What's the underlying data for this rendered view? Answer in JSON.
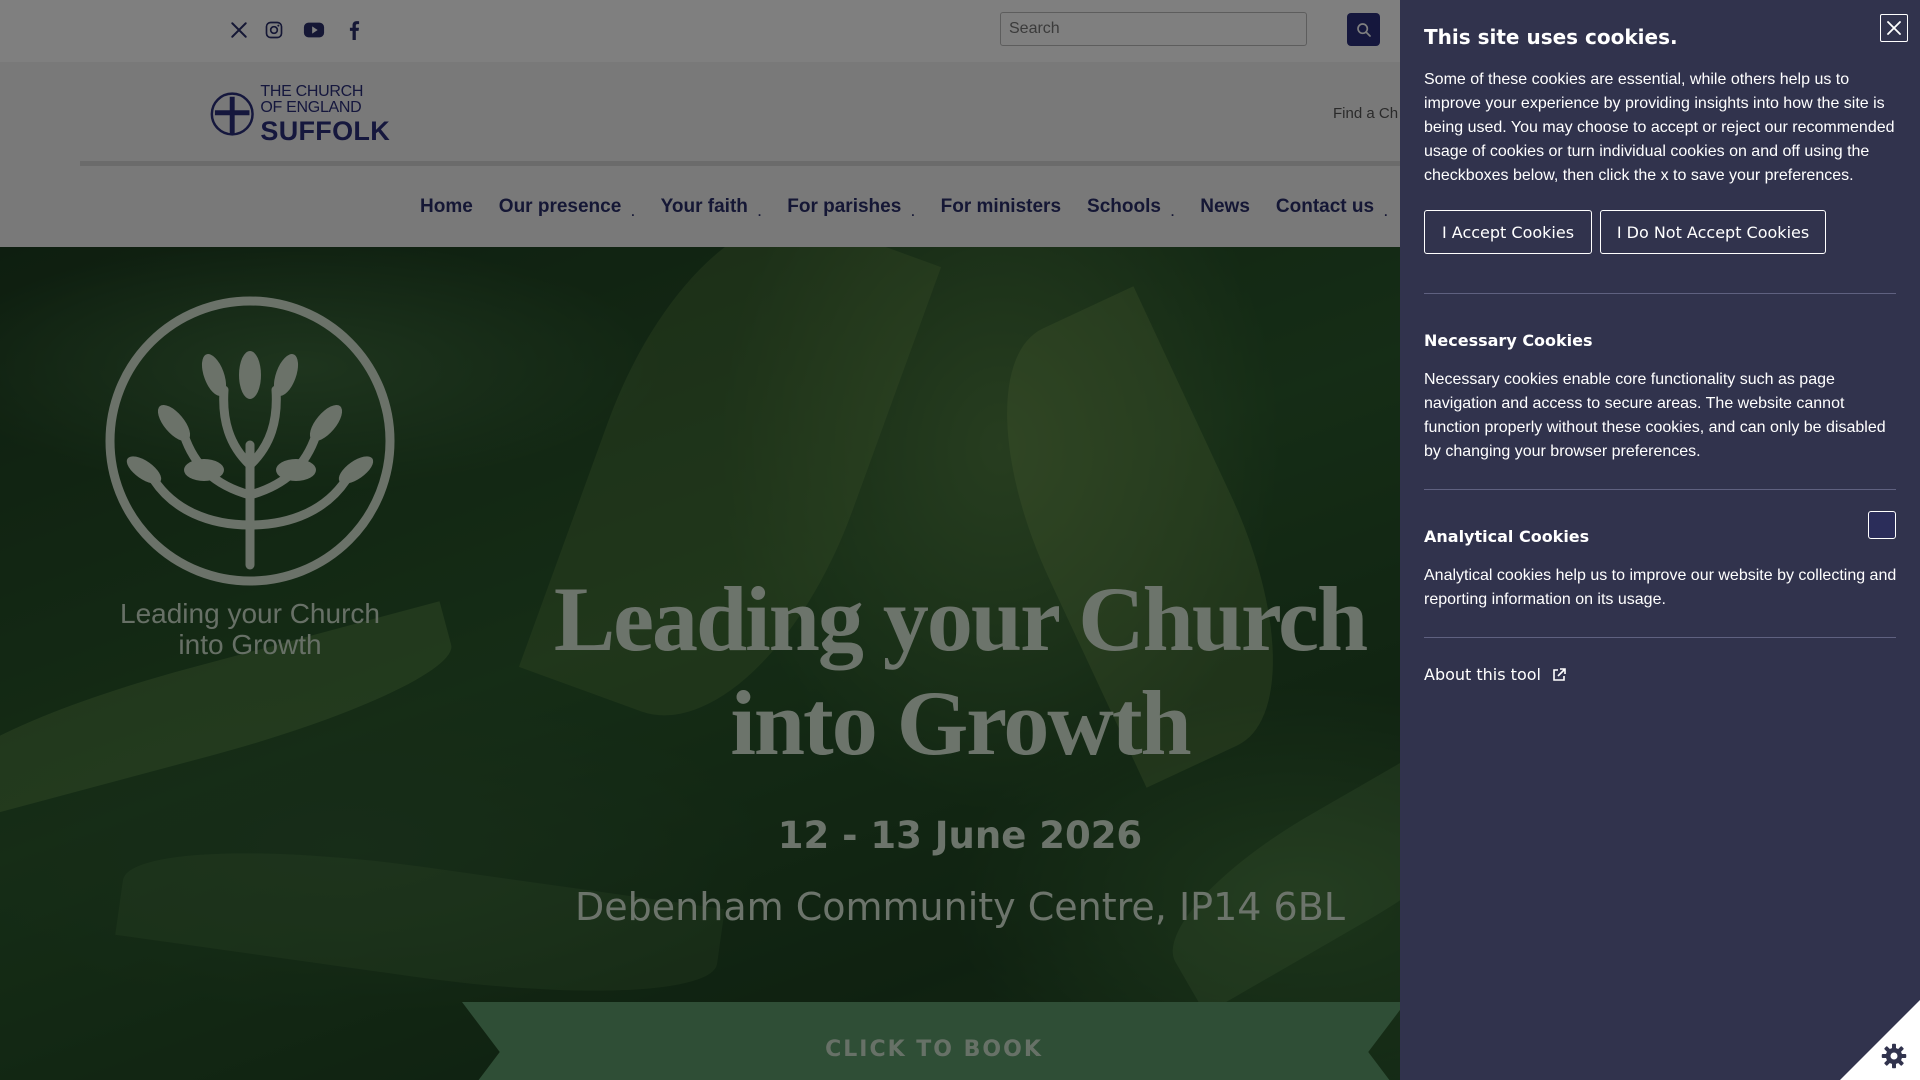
{
  "search": {
    "placeholder": "Search"
  },
  "logo": {
    "line1": "THE CHURCH",
    "line2": "OF ENGLAND",
    "line3": "SUFFOLK"
  },
  "header": {
    "find_church": "Find a Ch"
  },
  "nav": {
    "items": [
      {
        "label": "Home",
        "caret": ""
      },
      {
        "label": "Our presence",
        "caret": "."
      },
      {
        "label": "Your faith",
        "caret": "."
      },
      {
        "label": "For parishes",
        "caret": "."
      },
      {
        "label": "For ministers",
        "caret": ""
      },
      {
        "label": "Schools",
        "caret": "."
      },
      {
        "label": "News",
        "caret": ""
      },
      {
        "label": "Contact us",
        "caret": "."
      }
    ]
  },
  "hero": {
    "logo_text_line1": "Leading your Church",
    "logo_text_line2": "into Growth",
    "title_line1": "Leading your Church",
    "title_line2": "into Growth",
    "date": "12 - 13 June 2026",
    "venue": "Debenham Community Centre, IP14 6BL",
    "cta": "CLICK TO BOOK"
  },
  "cookies": {
    "title": "This site uses cookies.",
    "intro": "Some of these cookies are essential, while others help us to improve your experience by providing insights into how the site is being used. You may choose to accept or reject our recommended usage of cookies or turn individual cookies on and off using the checkboxes below, then click the x to save your preferences.",
    "accept_label": "I Accept Cookies",
    "reject_label": "I Do Not Accept Cookies",
    "necessary_title": "Necessary Cookies",
    "necessary_text": "Necessary cookies enable core functionality such as page navigation and access to secure areas. The website cannot function properly without these cookies, and can only be disabled by changing your browser preferences.",
    "analytical_title": "Analytical Cookies",
    "analytical_text": "Analytical cookies help us to improve our website by collecting and reporting information on its usage.",
    "analytical_checked": false,
    "about_label": "About this tool"
  },
  "colors": {
    "brand_navy": "#2a2f7b",
    "panel_bg": "#31334d",
    "hero_green": "#2b5a2c",
    "cta_green": "#5f9c6c"
  }
}
